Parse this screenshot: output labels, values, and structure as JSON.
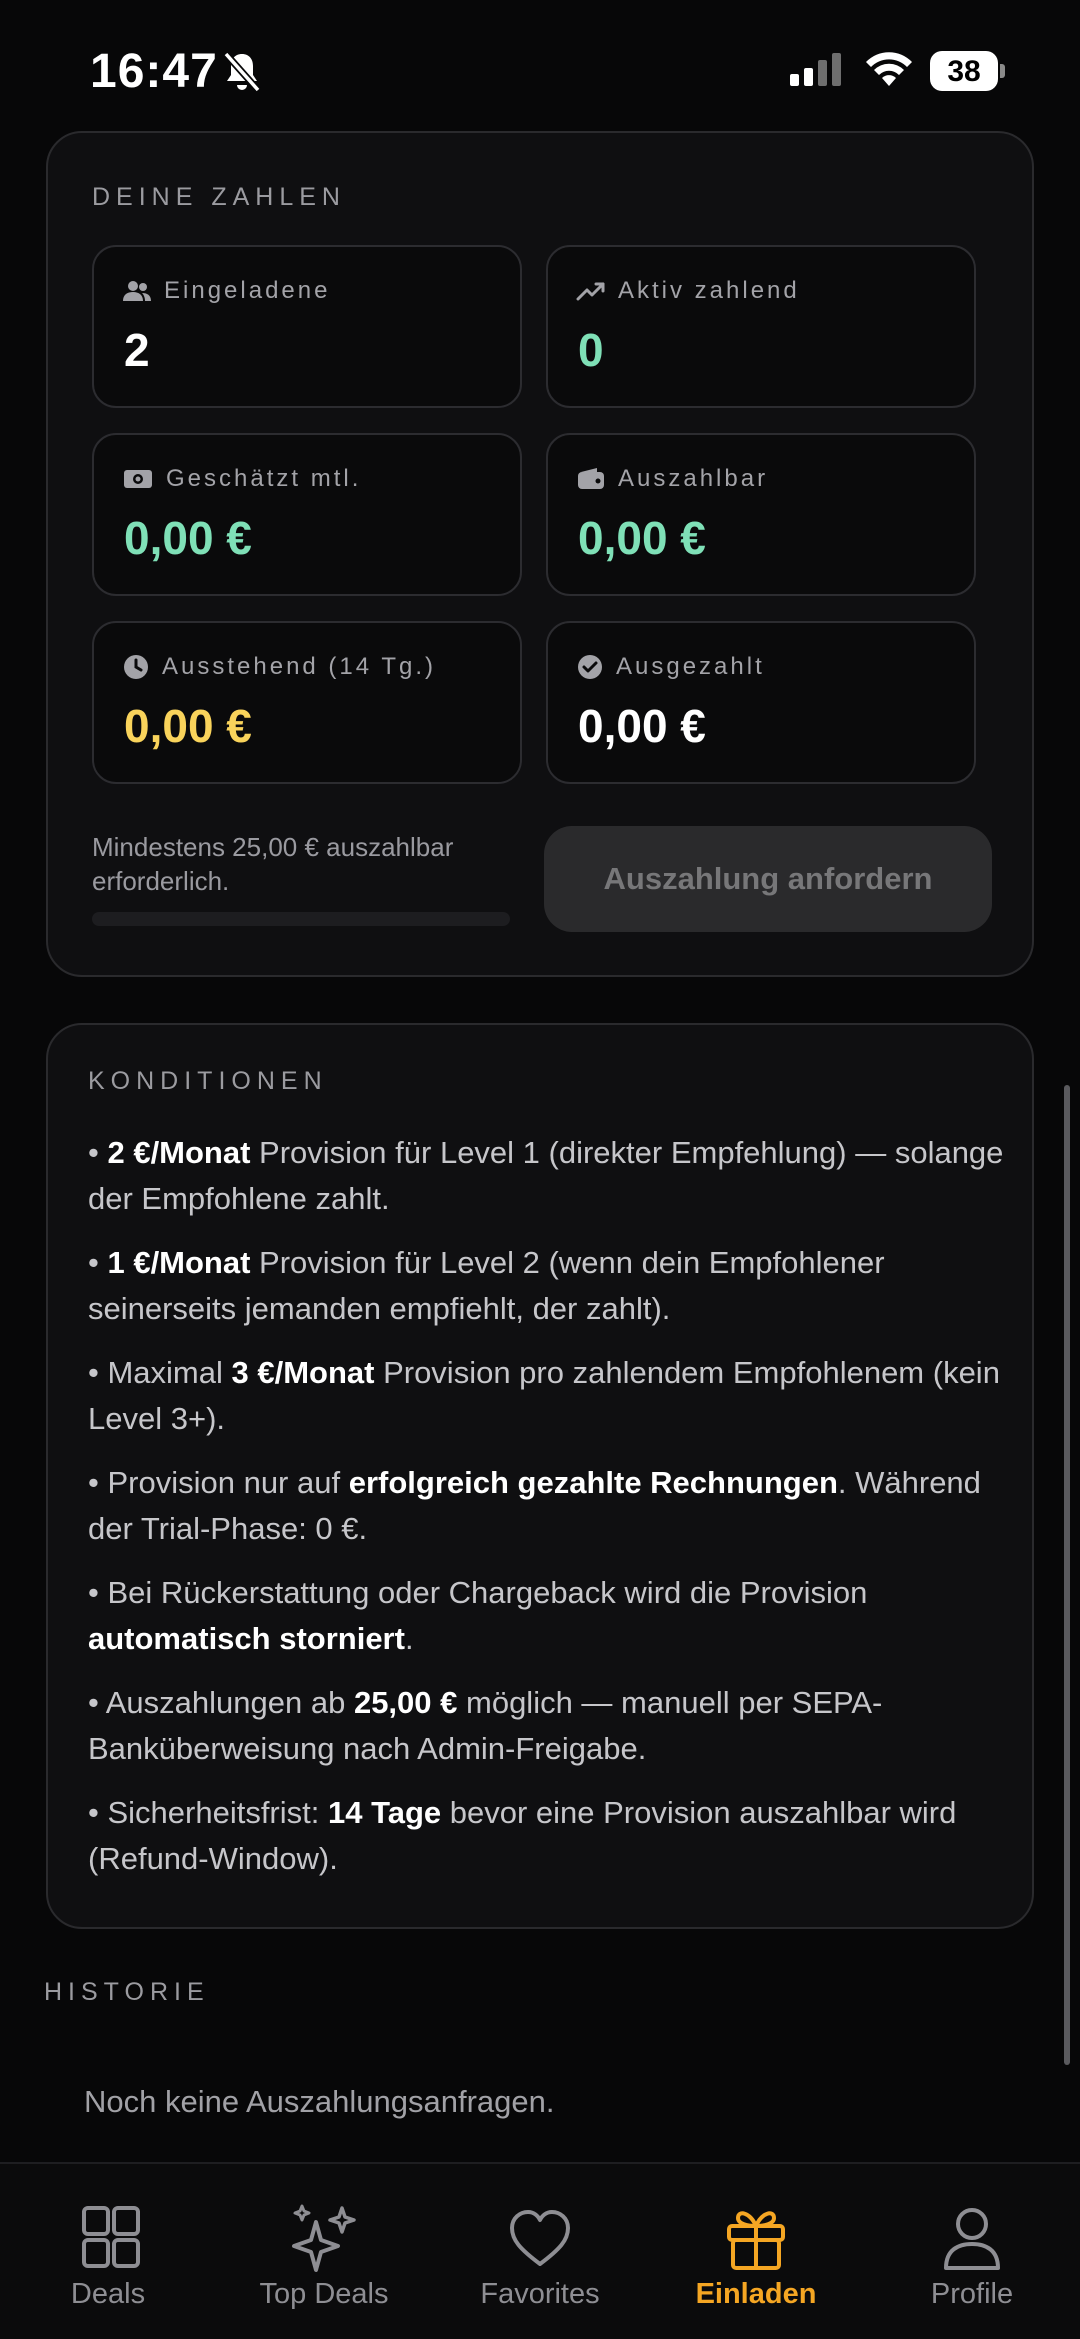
{
  "status_bar": {
    "time": "16:47",
    "battery": "38"
  },
  "numbers": {
    "title": "DEINE ZAHLEN",
    "stats": [
      {
        "label": "Eingeladene",
        "value": "2",
        "icon": "users-icon"
      },
      {
        "label": "Aktiv zahlend",
        "value": "0",
        "icon": "trending-up-icon"
      },
      {
        "label": "Geschätzt mtl.",
        "value": "0,00 €",
        "icon": "money-icon"
      },
      {
        "label": "Auszahlbar",
        "value": "0,00 €",
        "icon": "wallet-icon"
      },
      {
        "label": "Ausstehend (14 Tg.)",
        "value": "0,00 €",
        "icon": "clock-icon"
      },
      {
        "label": "Ausgezahlt",
        "value": "0,00 €",
        "icon": "check-circle-icon"
      }
    ],
    "min_note": "Mindestens 25,00 € auszahlbar erforderlich.",
    "progress": 0,
    "payout_button": "Auszahlung anfordern"
  },
  "conditions": {
    "title": "KONDITIONEN",
    "items": [
      [
        {
          "t": "• "
        },
        {
          "t": "2 €/Monat",
          "b": true
        },
        {
          "t": " Provision für Level 1 (direkter Empfehlung) — solange der Empfohlene zahlt."
        }
      ],
      [
        {
          "t": "• "
        },
        {
          "t": "1 €/Monat",
          "b": true
        },
        {
          "t": " Provision für Level 2 (wenn dein Empfohlener seinerseits jemanden empfiehlt, der zahlt)."
        }
      ],
      [
        {
          "t": "• Maximal "
        },
        {
          "t": "3 €/Monat",
          "b": true
        },
        {
          "t": " Provision pro zahlendem Empfohlenem (kein Level 3+)."
        }
      ],
      [
        {
          "t": "• Provision nur auf "
        },
        {
          "t": "erfolgreich gezahlte Rechnungen",
          "b": true
        },
        {
          "t": ". Während der Trial-Phase: 0 €."
        }
      ],
      [
        {
          "t": "• Bei Rückerstattung oder Chargeback wird die Provision "
        },
        {
          "t": "automatisch storniert",
          "b": true
        },
        {
          "t": "."
        }
      ],
      [
        {
          "t": "• Auszahlungen ab "
        },
        {
          "t": "25,00 €",
          "b": true
        },
        {
          "t": " möglich — manuell per SEPA-Banküberweisung nach Admin-Freigabe."
        }
      ],
      [
        {
          "t": "• Sicherheitsfrist: "
        },
        {
          "t": "14 Tage",
          "b": true
        },
        {
          "t": " bevor eine Provision auszahlbar wird (Refund-Window)."
        }
      ]
    ]
  },
  "history": {
    "title": "HISTORIE",
    "empty": "Noch keine Auszahlungsanfragen."
  },
  "tabs": [
    {
      "label": "Deals",
      "icon": "grid-icon"
    },
    {
      "label": "Top Deals",
      "icon": "sparkles-icon"
    },
    {
      "label": "Favorites",
      "icon": "heart-icon"
    },
    {
      "label": "Einladen",
      "icon": "gift-icon",
      "active": true
    },
    {
      "label": "Profile",
      "icon": "user-icon"
    }
  ],
  "colors": {
    "accent": "#f5a623",
    "positive": "#7fe0b7",
    "pending": "#f9d35b"
  }
}
